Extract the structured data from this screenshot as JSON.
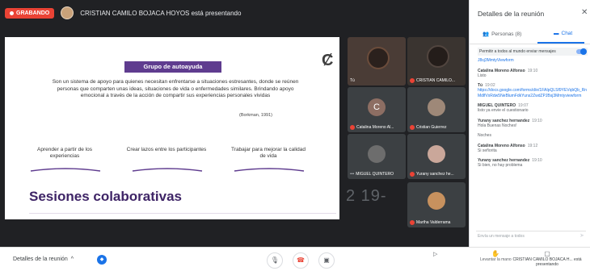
{
  "topbar": {
    "recording": "GRABANDO",
    "presenter": "CRISTIAN CAMILO BOJACA HOYOS está presentando"
  },
  "slide": {
    "title": "Grupo de autoayuda",
    "body": "Son un sistema de apoyo para quienes necesitan enfrentarse a situaciones estresantes, donde se reúnen personas que comparten unas ideas, situaciones de vida o enfermedades similares. Brindando apoyo emocional a través de la acción de compartir sus experiencias personales vividas",
    "citation": "(Borkman, 1991)",
    "pillars": [
      "Aprender a partir de los experiencias",
      "Crear lazos entre los participantes",
      "Trabajar para mejorar la calidad de vida"
    ],
    "heading": "Sesiones colaborativas",
    "background_time": "2 19-"
  },
  "participants": {
    "you_label": "Tú",
    "tiles": [
      {
        "name": "CRISTIAN CAMILO...",
        "type": "video"
      },
      {
        "name": "Catalina Moreno Al...",
        "type": "initial",
        "initial": "C"
      },
      {
        "name": "Cristian Guierrez",
        "type": "photo"
      },
      {
        "name": "MIGUEL QUINTERO",
        "type": "photo"
      },
      {
        "name": "Yurany sanchez he...",
        "type": "photo"
      },
      {
        "name": "Martha Valderrama",
        "type": "photo"
      }
    ]
  },
  "panel": {
    "title": "Detalles de la reunión",
    "tab_people": "Personas (8)",
    "tab_chat": "Chat",
    "allow_messages": "Permitir a todos al mundo enviar mensajes",
    "messages": [
      {
        "author": "",
        "time": "",
        "lines": [],
        "link": "J8sj3MmtyViewform"
      },
      {
        "author": "Catalina Moreno Alfonso",
        "time": "19:10",
        "lines": [
          "Listo"
        ],
        "link": ""
      },
      {
        "author": "Tú",
        "time": "19:02",
        "lines": [],
        "link": "https://docs.google.com/forms/d/e/1FAIpQLSf9YEVqbQb_RnMdlfVxRdw5NeBlumFdkYuns2ZwdZPJBsj3Mmtyviewform"
      },
      {
        "author": "MIGUEL QUINTERO",
        "time": "19:07",
        "lines": [
          "listo ya envie el cuestionario"
        ],
        "link": ""
      },
      {
        "author": "Yurany sanchez hernandez",
        "time": "19:10",
        "lines": [
          "Hola Buenas Noches!"
        ],
        "link": ""
      },
      {
        "author": "",
        "time": "",
        "lines": [
          "Noches"
        ],
        "link": ""
      },
      {
        "author": "Catalina Moreno Alfonso",
        "time": "19:12",
        "lines": [
          "Si señorita"
        ],
        "link": ""
      },
      {
        "author": "Yurany sanchez hernandez",
        "time": "19:10",
        "lines": [
          "Si bien, no hay problema"
        ],
        "link": ""
      }
    ],
    "input_placeholder": "Envía un mensaje a todos"
  },
  "bottombar": {
    "details_label": "Detalles de la reunión",
    "raise_hand": "Levantar la mano",
    "presenting_label": "CRISTIAN CAMILO BOJACA H... está presentando"
  }
}
